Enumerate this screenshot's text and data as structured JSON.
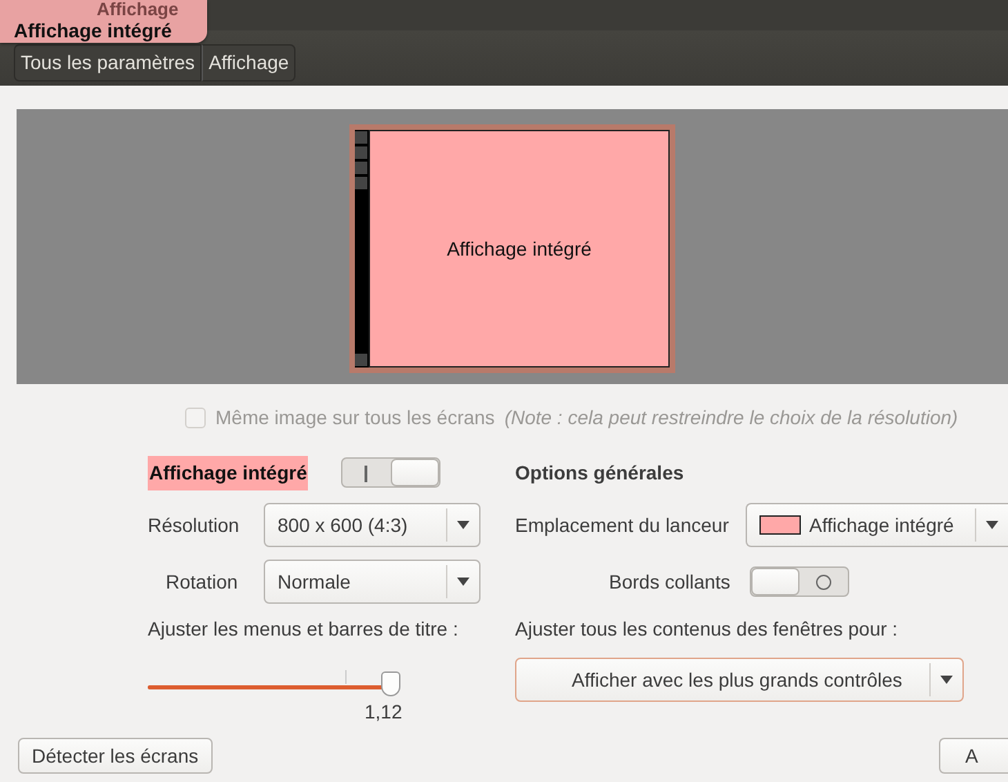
{
  "window": {
    "title": "Affichage"
  },
  "overlay_label": "Affichage intégré",
  "breadcrumbs": [
    "Tous les paramètres",
    "Affichage"
  ],
  "monitor": {
    "label": "Affichage intégré",
    "color": "#ffa8a8"
  },
  "mirror": {
    "label": "Même image sur tous les écrans",
    "note": "(Note : cela peut restreindre le choix de la résolution)",
    "checked": false,
    "disabled": true
  },
  "display": {
    "name": "Affichage intégré",
    "on": true,
    "color": "#ffa8a8",
    "resolution_label": "Résolution",
    "resolution": "800 x 600 (4:3)",
    "rotation_label": "Rotation",
    "rotation": "Normale",
    "scale_label": "Ajuster les menus et barres de titre :",
    "scale": {
      "level": 0.99,
      "reading": "1,12"
    }
  },
  "general": {
    "heading": "Options générales",
    "launcher_label": "Emplacement du lanceur",
    "launcher": {
      "value": "Affichage intégré",
      "color": "#ffa8a8"
    },
    "sticky_label": "Bords collants",
    "sticky_on": false,
    "contents_label": "Ajuster tous les contenus des fenêtres pour :",
    "contents": "Afficher avec les plus grands contrôles"
  },
  "buttons": [
    "Détecter les écrans",
    "A"
  ]
}
